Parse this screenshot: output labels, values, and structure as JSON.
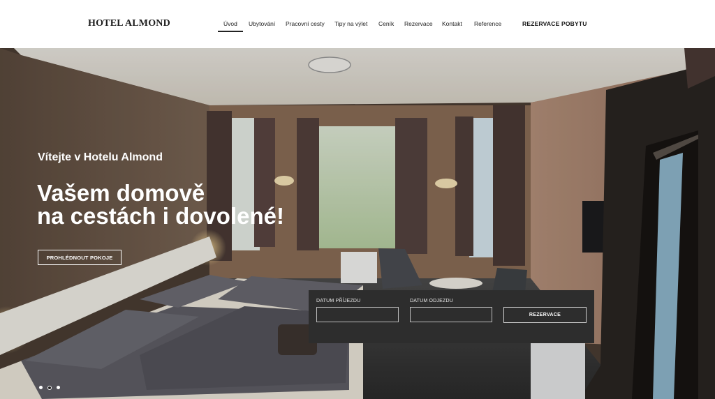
{
  "header": {
    "logo": "HOTEL ALMOND",
    "nav": [
      {
        "label": "Úvod",
        "active": true
      },
      {
        "label": "Ubytování"
      },
      {
        "label": "Pracovní cesty"
      },
      {
        "label": "Tipy na výlet"
      },
      {
        "label": "Ceník"
      },
      {
        "label": "Rezervace"
      },
      {
        "label": "Kontakt"
      },
      {
        "label": "Reference"
      }
    ],
    "cta": "REZERVACE POBYTU"
  },
  "hero": {
    "subtitle": "Vítejte v Hotelu Almond",
    "title_line1": "Vašem domově",
    "title_line2": "na cestách i dovolené!",
    "button": "PROHLÉDNOUT POKOJE",
    "slides": 3,
    "active_slide": 2
  },
  "booking": {
    "arrival_label": "DATUM PŘÍJEZDU",
    "arrival_value": "",
    "departure_label": "DATUM ODJEZDU",
    "departure_value": "",
    "submit": "REZERVACE"
  },
  "colors": {
    "booking_bg": "#2d2d2d",
    "header_bg": "#ffffff",
    "text_dark": "#222222"
  }
}
